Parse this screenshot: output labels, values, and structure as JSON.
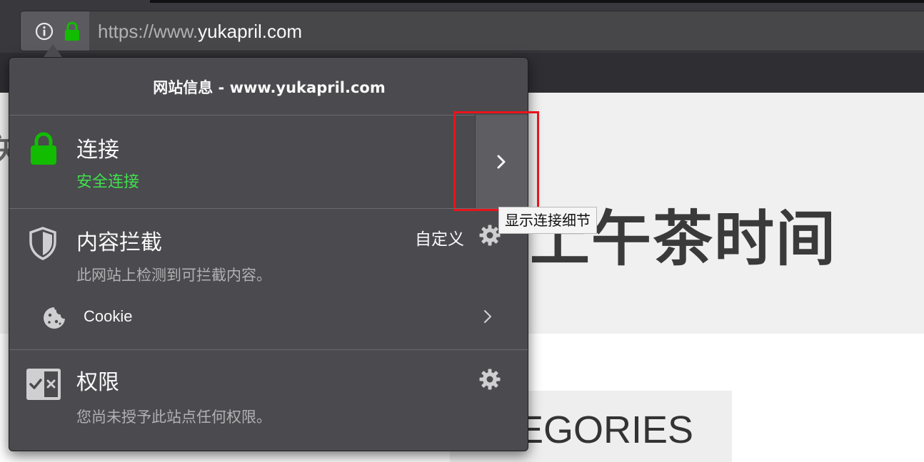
{
  "urlbar": {
    "url_prefix": "https://www.",
    "url_host": "yukapril.com"
  },
  "page": {
    "edge_char": "关",
    "hero_title": "上午茶时间",
    "categories_text": "TEGORIES"
  },
  "popup": {
    "title": "网站信息 - www.yukapril.com",
    "connection": {
      "title": "连接",
      "status": "安全连接",
      "status_color": "#3fe14b"
    },
    "content_blocking": {
      "title": "内容拦截",
      "custom_label": "自定义",
      "description": "此网站上检测到可拦截内容。",
      "cookie_label": "Cookie"
    },
    "permissions": {
      "title": "权限",
      "description": "您尚未授予此站点任何权限。"
    }
  },
  "tooltip": {
    "text": "显示连接细节"
  },
  "colors": {
    "accent_green": "#12bc00",
    "highlight": "#e8141b",
    "panel_bg": "#4a4a4f"
  }
}
